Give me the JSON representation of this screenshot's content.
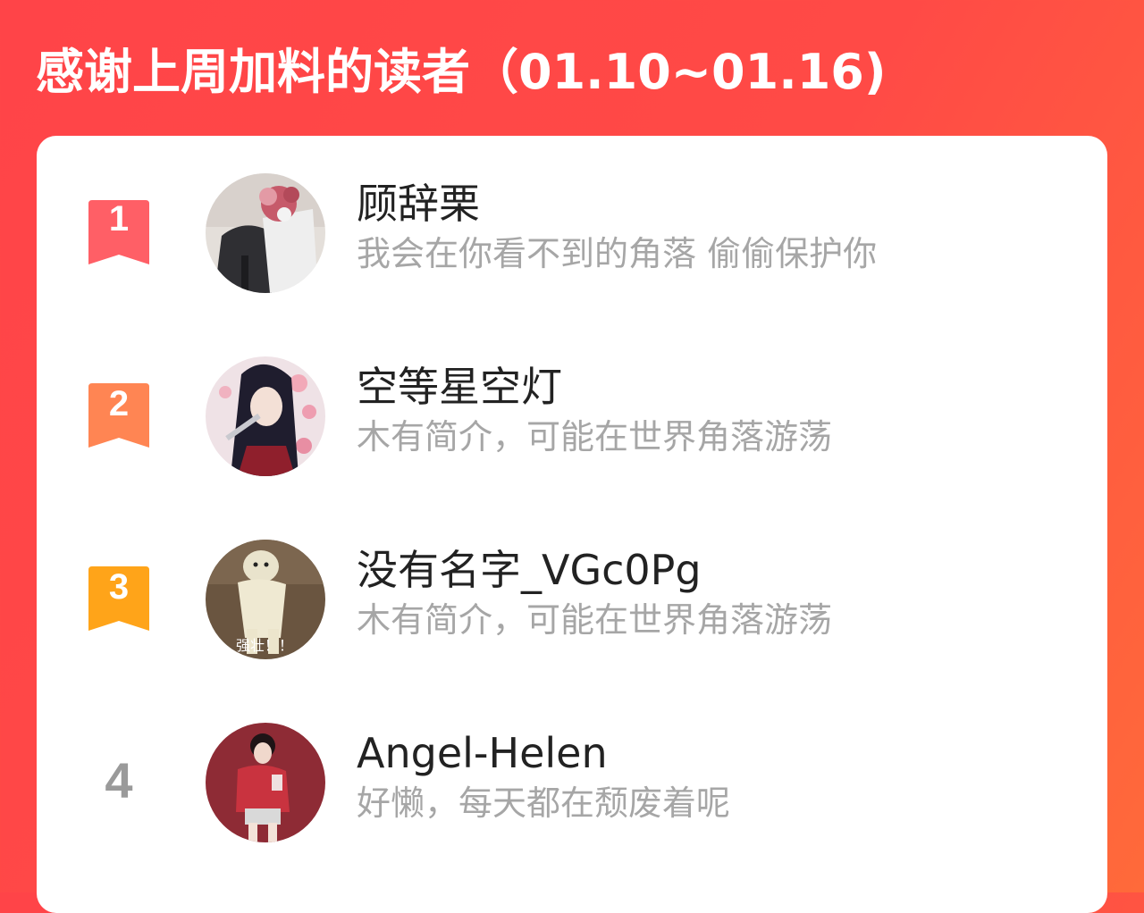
{
  "header": {
    "title": "感谢上周加料的读者（01.10~01.16)"
  },
  "colors": {
    "background": "#ff4448",
    "badge_1": "#ff5f66",
    "badge_2": "#ff8553",
    "badge_3": "#ffa419",
    "plain_rank": "#9a9a9a",
    "name_text": "#222222",
    "bio_text": "#a6a6a6"
  },
  "readers": [
    {
      "rank": "1",
      "name": "顾辞栗",
      "bio": "我会在你看不到的角落 偷偷保护你"
    },
    {
      "rank": "2",
      "name": "空等星空灯",
      "bio": "木有简介，可能在世界角落游荡"
    },
    {
      "rank": "3",
      "name": "没有名字_VGc0Pg",
      "bio": "木有简介，可能在世界角落游荡",
      "avatar_caption": "强壮！！"
    },
    {
      "rank": "4",
      "name": "Angel-Helen",
      "bio": "好懒，每天都在颓废着呢"
    }
  ]
}
